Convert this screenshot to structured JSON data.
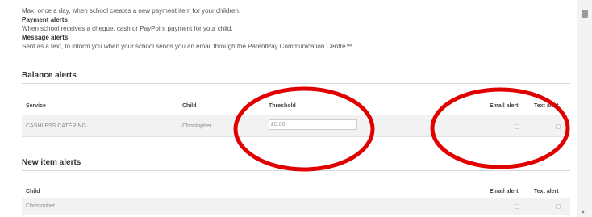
{
  "intro": {
    "line1": "Max. once a day, when school creates a new payment item for your children.",
    "payment_heading": "Payment alerts",
    "payment_text": "When school receives a cheque, cash or PayPoint payment for your child.",
    "message_heading": "Message alerts",
    "message_text": "Sent as a text, to inform you when your school sends you an email through the ParentPay Communication Centre™."
  },
  "balance_alerts": {
    "title": "Balance alerts",
    "columns": {
      "service": "Service",
      "child": "Child",
      "threshold": "Threshold",
      "email_alert": "Email alert",
      "text_alert": "Text alert"
    },
    "row": {
      "service": "CASHLESS CATERING",
      "child": "Christopher",
      "threshold_value": "£0.00",
      "email_alert_checked": false,
      "text_alert_checked": false
    }
  },
  "new_item_alerts": {
    "title": "New item alerts",
    "columns": {
      "child": "Child",
      "email_alert": "Email alert",
      "text_alert": "Text alert"
    },
    "row": {
      "child": "Christopher",
      "email_alert_checked": false,
      "text_alert_checked": false
    }
  },
  "annotation_color": "#e00000"
}
